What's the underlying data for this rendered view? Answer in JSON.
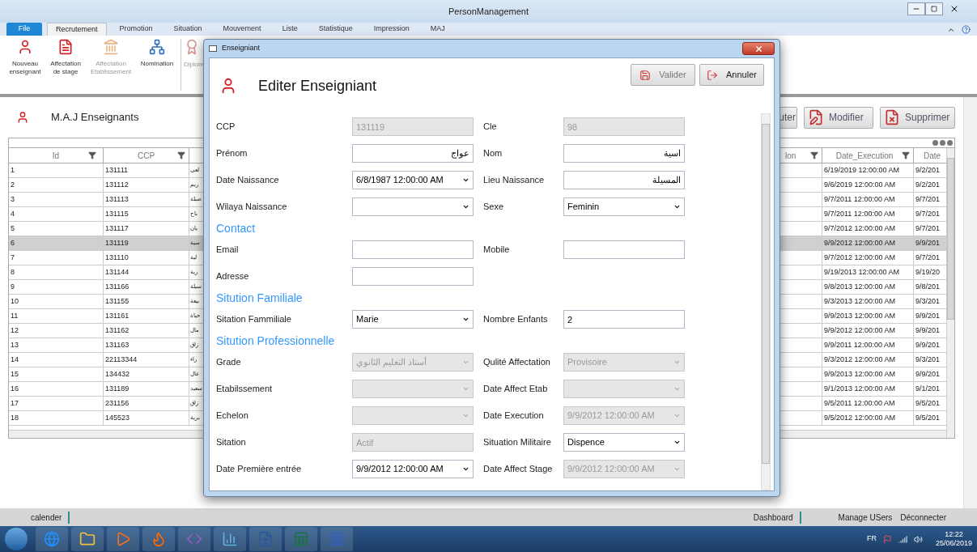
{
  "window": {
    "title": "PersonManagement"
  },
  "ribbon_tabs": [
    {
      "label": "File",
      "kind": "file",
      "selected": false
    },
    {
      "label": "Recrutement",
      "kind": "tab",
      "selected": true
    },
    {
      "label": "Promotion",
      "kind": "tab",
      "selected": false
    },
    {
      "label": "Situation",
      "kind": "tab",
      "selected": false
    },
    {
      "label": "Mouvement",
      "kind": "tab",
      "selected": false
    },
    {
      "label": "Liste",
      "kind": "tab",
      "selected": false
    },
    {
      "label": "Statistique",
      "kind": "tab",
      "selected": false
    },
    {
      "label": "Impression",
      "kind": "tab",
      "selected": false
    },
    {
      "label": "MAJ",
      "kind": "tab",
      "selected": false
    }
  ],
  "ribbon_items": [
    {
      "label": "Nouveau enseignant",
      "disabled": false
    },
    {
      "label": "Affectation de stage",
      "disabled": false
    },
    {
      "label": "Affectation Etablissement",
      "disabled": true
    },
    {
      "label": "Nomination",
      "disabled": false
    },
    {
      "label": "Diplom",
      "disabled": true
    }
  ],
  "page": {
    "title": "M.A.J Enseignants",
    "buttons": [
      "uter",
      "Modifier",
      "Supprimer"
    ]
  },
  "table": {
    "headers": {
      "id": "Id",
      "ccp": "CCP",
      "partial_column": "lon",
      "date_execution": "Date_Execution",
      "last_column": "Date"
    },
    "rows": [
      {
        "id": "1",
        "ccp": "131111",
        "column_3": "لعى",
        "date_execution": "6/19/2019 12:00:00 AM",
        "last_column": "9/2/201",
        "selected": false
      },
      {
        "id": "2",
        "ccp": "131112",
        "column_3": "ريم",
        "date_execution": "9/6/2019 12:00:00 AM",
        "last_column": "9/2/201",
        "selected": false
      },
      {
        "id": "3",
        "ccp": "131113",
        "column_3": "صبلة",
        "date_execution": "9/7/2011 12:00:00 AM",
        "last_column": "9/7/201",
        "selected": false
      },
      {
        "id": "4",
        "ccp": "131115",
        "column_3": "باح",
        "date_execution": "9/7/2011 12:00:00 AM",
        "last_column": "9/7/201",
        "selected": false
      },
      {
        "id": "5",
        "ccp": "131117",
        "column_3": "يان",
        "date_execution": "9/7/2012 12:00:00 AM",
        "last_column": "9/7/201",
        "selected": false
      },
      {
        "id": "6",
        "ccp": "131119",
        "column_3": "سية",
        "date_execution": "9/9/2012 12:00:00 AM",
        "last_column": "9/9/201",
        "selected": true
      },
      {
        "id": "7",
        "ccp": "131110",
        "column_3": "لية",
        "date_execution": "9/7/2012 12:00:00 AM",
        "last_column": "9/7/201",
        "selected": false
      },
      {
        "id": "8",
        "ccp": "131144",
        "column_3": "رية",
        "date_execution": "9/19/2013 12:00:00 AM",
        "last_column": "9/19/20",
        "selected": false
      },
      {
        "id": "9",
        "ccp": "131166",
        "column_3": "سيلة",
        "date_execution": "9/8/2013 12:00:00 AM",
        "last_column": "9/8/201",
        "selected": false
      },
      {
        "id": "10",
        "ccp": "131155",
        "column_3": "بيعة",
        "date_execution": "9/3/2013 12:00:00 AM",
        "last_column": "9/3/201",
        "selected": false
      },
      {
        "id": "11",
        "ccp": "131161",
        "column_3": "حياة",
        "date_execution": "9/9/2013 12:00:00 AM",
        "last_column": "9/9/201",
        "selected": false
      },
      {
        "id": "12",
        "ccp": "131162",
        "column_3": "مال",
        "date_execution": "9/9/2012 12:00:00 AM",
        "last_column": "9/9/201",
        "selected": false
      },
      {
        "id": "13",
        "ccp": "131163",
        "column_3": "زاق",
        "date_execution": "9/9/2011 12:00:00 AM",
        "last_column": "9/9/201",
        "selected": false
      },
      {
        "id": "14",
        "ccp": "22113344",
        "column_3": "راء",
        "date_execution": "9/3/2012 12:00:00 AM",
        "last_column": "9/3/201",
        "selected": false
      },
      {
        "id": "15",
        "ccp": "134432",
        "column_3": "عال",
        "date_execution": "9/9/2013 12:00:00 AM",
        "last_column": "9/9/201",
        "selected": false
      },
      {
        "id": "16",
        "ccp": "131189",
        "column_3": "سعيد",
        "date_execution": "9/1/2013 12:00:00 AM",
        "last_column": "9/1/201",
        "selected": false
      },
      {
        "id": "17",
        "ccp": "231156",
        "column_3": "زاق",
        "date_execution": "9/5/2011 12:00:00 AM",
        "last_column": "9/5/201",
        "selected": false
      },
      {
        "id": "18",
        "ccp": "145523",
        "column_3": "برية",
        "date_execution": "9/5/2012 12:00:00 AM",
        "last_column": "9/5/201",
        "selected": false
      }
    ]
  },
  "dialog": {
    "title": "Enseigniant",
    "heading": "Editer Enseigniant",
    "buttons": [
      {
        "label": "Valider",
        "kind": "save",
        "disabled": true
      },
      {
        "label": "Annuler",
        "kind": "cancel",
        "disabled": false
      }
    ],
    "sections": [
      {
        "fields": [
          {
            "label": "CCP",
            "kind": "text",
            "value": "131119",
            "disabled": true
          },
          {
            "label": "Cle",
            "kind": "text",
            "value": "98",
            "disabled": true
          },
          {
            "label": "Prénom",
            "kind": "text",
            "value": "عواج",
            "disabled": false
          },
          {
            "label": "Nom",
            "kind": "text",
            "value": "اسية",
            "disabled": false
          },
          {
            "label": "Date Naissance",
            "kind": "date",
            "value": "6/8/1987 12:00:00 AM",
            "disabled": false
          },
          {
            "label": "Lieu Naissance",
            "kind": "text",
            "value": "المسيلة",
            "disabled": false
          },
          {
            "label": "Wilaya Naissance",
            "kind": "combo",
            "disabled": false
          },
          {
            "label": "Sexe",
            "kind": "combo",
            "value": "Feminin",
            "disabled": false
          }
        ]
      },
      {
        "title": "Contact",
        "fields": [
          {
            "label": "Email",
            "kind": "text",
            "disabled": false
          },
          {
            "label": "Mobile",
            "kind": "text",
            "disabled": false
          },
          {
            "label": "Adresse",
            "kind": "text",
            "disabled": false
          }
        ]
      },
      {
        "title": "Sitution Familiale",
        "fields": [
          {
            "label": "Sitation Fammiliale",
            "kind": "combo",
            "value": "Marie",
            "disabled": false
          },
          {
            "label": "Nombre Enfants",
            "kind": "text",
            "value": "2",
            "disabled": false
          }
        ]
      },
      {
        "title": "Sitution Professionnelle",
        "fields": [
          {
            "label": "Grade",
            "kind": "combo",
            "value": "أستاذ التعليم الثانوي",
            "disabled": true
          },
          {
            "label": "Qulité Affectation",
            "kind": "combo",
            "value": "Provisoire",
            "disabled": true
          },
          {
            "label": "Etabilssement",
            "kind": "combo",
            "disabled": true
          },
          {
            "label": "Date Affect Etab",
            "kind": "date",
            "disabled": true
          },
          {
            "label": "Echelon",
            "kind": "combo",
            "disabled": true
          },
          {
            "label": "Date Execution",
            "kind": "date",
            "value": "9/9/2012 12:00:00 AM",
            "disabled": true
          },
          {
            "label": "Sitation",
            "kind": "text",
            "value": "Actif",
            "disabled": true
          },
          {
            "label": "Situation Militaire",
            "kind": "combo",
            "value": "Dispence",
            "disabled": false
          },
          {
            "label": "Date Première entrée",
            "kind": "date",
            "value": "9/9/2012 12:00:00 AM",
            "disabled": false
          },
          {
            "label": "Date Affect Stage",
            "kind": "date",
            "value": "9/9/2012 12:00:00 AM",
            "disabled": true
          }
        ]
      }
    ]
  },
  "status_bar": {
    "left": [
      "calender"
    ],
    "right": [
      "Dashboard",
      "Manage USers",
      "Déconnecter"
    ]
  },
  "taskbar": {
    "language": "FR",
    "time": "12:22",
    "date": "25/06/2019"
  }
}
